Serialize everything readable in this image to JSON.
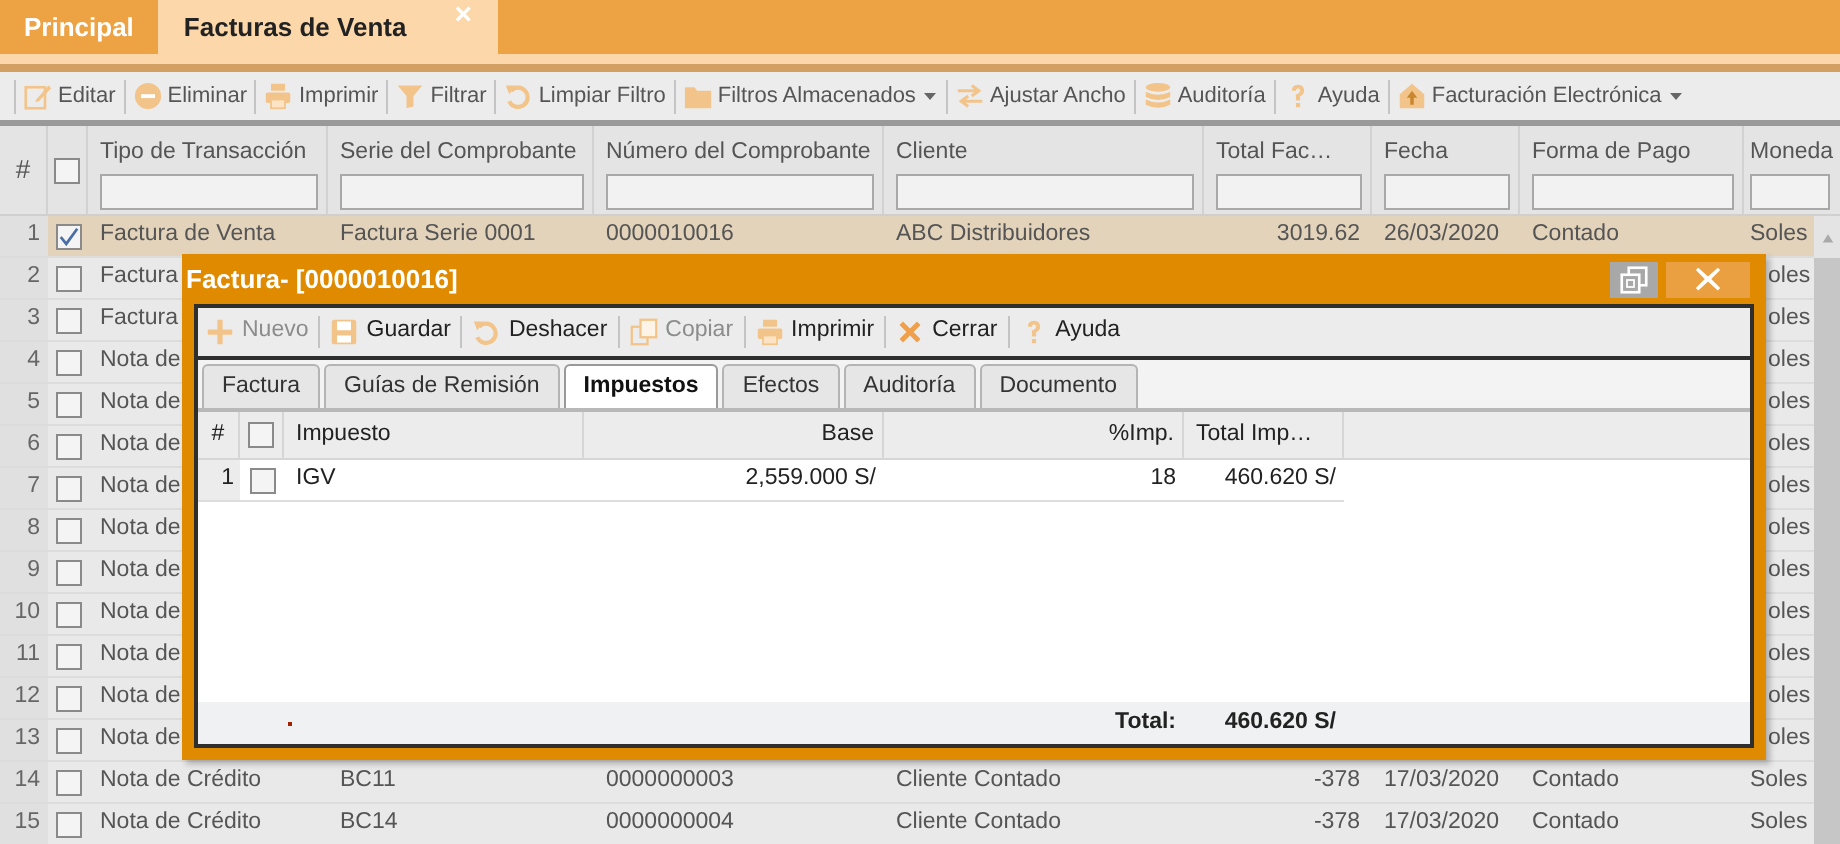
{
  "tabs": [
    {
      "label": "Principal",
      "selected": false
    },
    {
      "label": "Facturas de Venta",
      "selected": true,
      "close": "×"
    }
  ],
  "toolbar": [
    {
      "label": "Editar",
      "dropdown": false
    },
    {
      "label": "Eliminar",
      "dropdown": false
    },
    {
      "label": "Imprimir",
      "dropdown": false
    },
    {
      "label": "Filtrar",
      "dropdown": false
    },
    {
      "label": "Limpiar Filtro",
      "dropdown": false
    },
    {
      "label": "Filtros Almacenados",
      "dropdown": true
    },
    {
      "label": "Ajustar Ancho",
      "dropdown": false
    },
    {
      "label": "Auditoría",
      "dropdown": false
    },
    {
      "label": "Ayuda",
      "dropdown": false
    },
    {
      "label": "Facturación Electrónica",
      "dropdown": true
    }
  ],
  "grid": {
    "number_header": "#",
    "all_checked": false,
    "columns": [
      {
        "label": "Tipo de Transacción"
      },
      {
        "label": "Serie del Comprobante"
      },
      {
        "label": "Número del Comprobante"
      },
      {
        "label": "Cliente"
      },
      {
        "label": "Total Fac…"
      },
      {
        "label": "Fecha"
      },
      {
        "label": "Forma de Pago"
      },
      {
        "label": "Moneda"
      }
    ],
    "rows": [
      {
        "number": "1",
        "checked": true,
        "selected": true,
        "kind": "full",
        "cells": [
          "Factura de Venta",
          "Factura Serie 0001",
          "0000010016",
          "ABC Distribuidores",
          "3019.62",
          "26/03/2020",
          "Contado",
          "Soles"
        ]
      },
      {
        "number": "2",
        "checked": false,
        "selected": false,
        "kind": "covered",
        "cells": [
          "Factura",
          "oles"
        ]
      },
      {
        "number": "3",
        "checked": false,
        "selected": false,
        "kind": "covered",
        "cells": [
          "Factura",
          "oles"
        ]
      },
      {
        "number": "4",
        "checked": false,
        "selected": false,
        "kind": "covered",
        "cells": [
          "Nota de",
          "oles"
        ]
      },
      {
        "number": "5",
        "checked": false,
        "selected": false,
        "kind": "covered",
        "cells": [
          "Nota de",
          "oles"
        ]
      },
      {
        "number": "6",
        "checked": false,
        "selected": false,
        "kind": "covered",
        "cells": [
          "Nota de",
          "oles"
        ]
      },
      {
        "number": "7",
        "checked": false,
        "selected": false,
        "kind": "covered",
        "cells": [
          "Nota de",
          "oles"
        ]
      },
      {
        "number": "8",
        "checked": false,
        "selected": false,
        "kind": "covered",
        "cells": [
          "Nota de",
          "oles"
        ]
      },
      {
        "number": "9",
        "checked": false,
        "selected": false,
        "kind": "covered",
        "cells": [
          "Nota de",
          "oles"
        ]
      },
      {
        "number": "10",
        "checked": false,
        "selected": false,
        "kind": "covered",
        "cells": [
          "Nota de",
          "oles"
        ]
      },
      {
        "number": "11",
        "checked": false,
        "selected": false,
        "kind": "covered",
        "cells": [
          "Nota de",
          "oles"
        ]
      },
      {
        "number": "12",
        "checked": false,
        "selected": false,
        "kind": "covered",
        "cells": [
          "Nota de",
          "oles"
        ]
      },
      {
        "number": "13",
        "checked": false,
        "selected": false,
        "kind": "covered",
        "cells": [
          "Nota de",
          "oles"
        ]
      },
      {
        "number": "14",
        "checked": false,
        "selected": false,
        "kind": "full",
        "cells": [
          "Nota de Crédito",
          "BC11",
          "0000000003",
          "Cliente Contado",
          "-378",
          "17/03/2020",
          "Contado",
          "Soles"
        ]
      },
      {
        "number": "15",
        "checked": false,
        "selected": false,
        "kind": "full",
        "cells": [
          "Nota de Crédito",
          "BC14",
          "0000000004",
          "Cliente Contado",
          "-378",
          "17/03/2020",
          "Contado",
          "Soles"
        ]
      }
    ]
  },
  "dialog": {
    "title": "Factura- [0000010016]",
    "toolbar": [
      {
        "label": "Nuevo",
        "disabled": true
      },
      {
        "label": "Guardar",
        "disabled": false
      },
      {
        "label": "Deshacer",
        "disabled": false
      },
      {
        "label": "Copiar",
        "disabled": true
      },
      {
        "label": "Imprimir",
        "disabled": false
      },
      {
        "label": "Cerrar",
        "disabled": false
      },
      {
        "label": "Ayuda",
        "disabled": false
      }
    ],
    "tabs": [
      {
        "label": "Factura",
        "selected": false
      },
      {
        "label": "Guías de Remisión",
        "selected": false
      },
      {
        "label": "Impuestos",
        "selected": true
      },
      {
        "label": "Efectos",
        "selected": false
      },
      {
        "label": "Auditoría",
        "selected": false
      },
      {
        "label": "Documento",
        "selected": false
      }
    ],
    "grid": {
      "number_header": "#",
      "all_checked": false,
      "columns": [
        {
          "label": "Impuesto"
        },
        {
          "label": "Base"
        },
        {
          "label": "%Imp."
        },
        {
          "label": "Total Imp…"
        }
      ],
      "rows": [
        {
          "number": "1",
          "checked": false,
          "cells": [
            "IGV",
            "2,559.000 S/",
            "18",
            "460.620 S/"
          ]
        }
      ]
    },
    "footer": {
      "total_label": "Total:",
      "total_value": "460.620 S/"
    }
  }
}
